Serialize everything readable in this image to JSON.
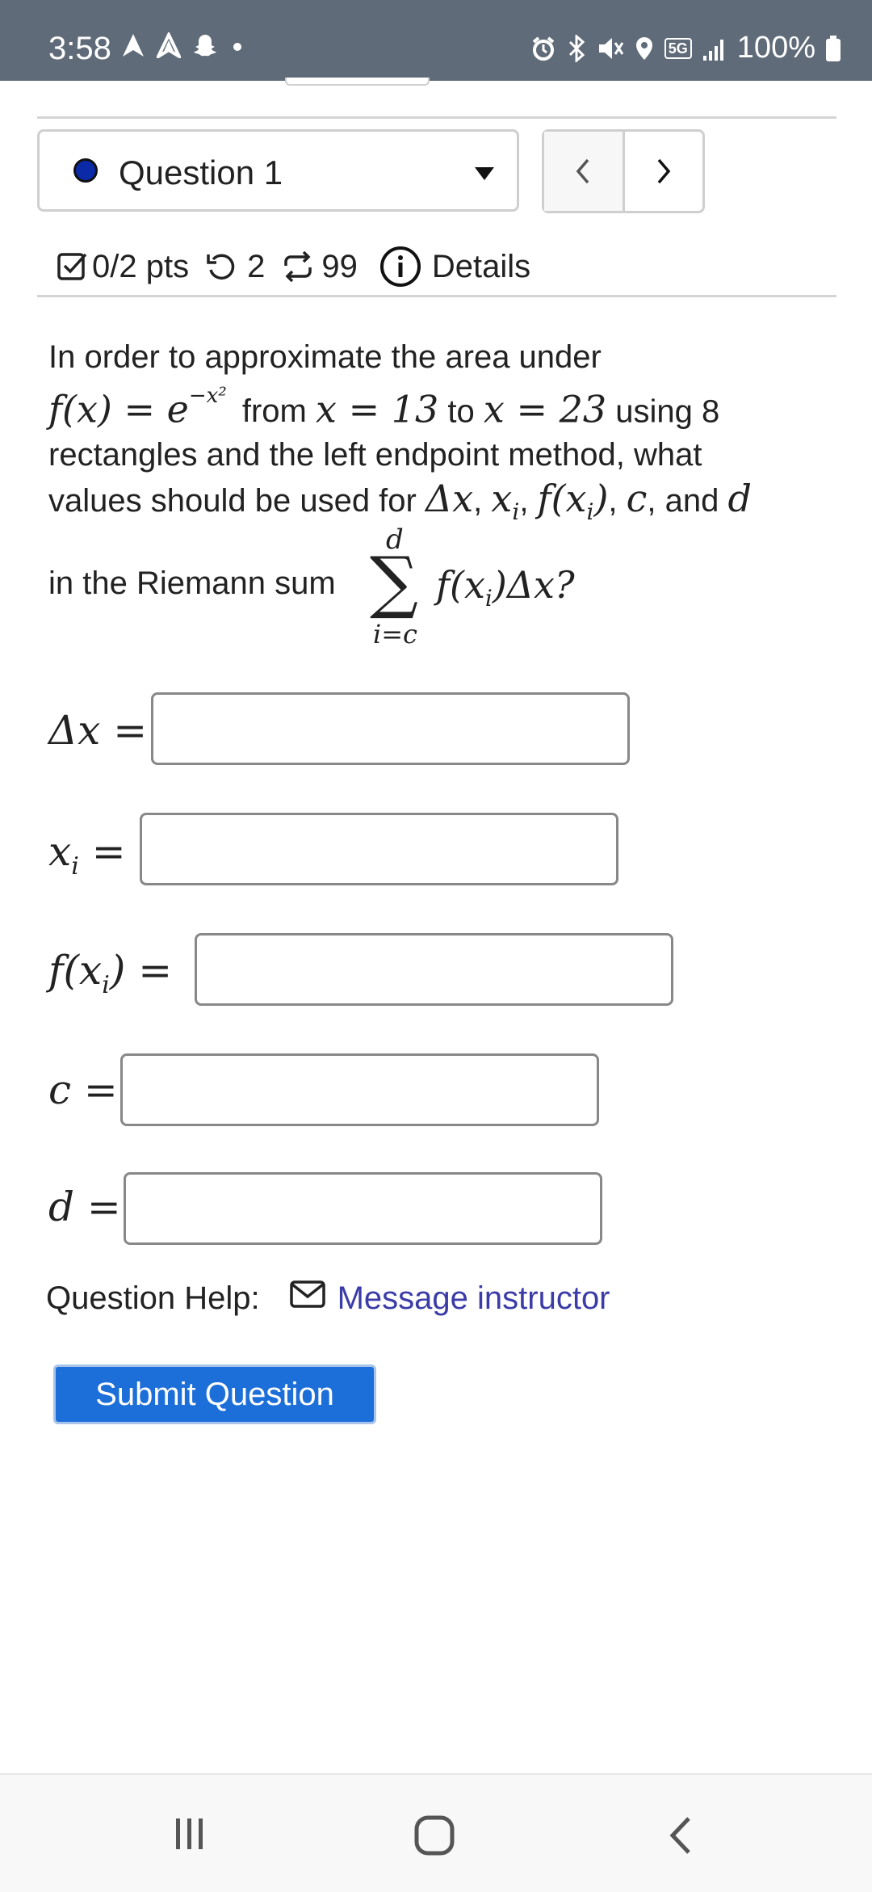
{
  "status_bar": {
    "time": "3:58",
    "battery": "100%",
    "icons_left": [
      "navigation-icon",
      "navigation-outline-icon",
      "snapchat-icon",
      "dot-icon"
    ],
    "icons_right": [
      "alarm-icon",
      "bluetooth-icon",
      "mute-icon",
      "location-icon",
      "5g-icon",
      "signal-icon",
      "battery-icon"
    ],
    "network": "5G"
  },
  "question_select": {
    "label": "Question 1",
    "dot_color": "#0a2aa8"
  },
  "meta": {
    "points": "0/2 pts",
    "retries": "2",
    "attempts": "99",
    "details": "Details"
  },
  "question": {
    "line1": "In order to approximate the area under",
    "fx": "f(x) = e",
    "exp": "−x²",
    "from": "from",
    "x_eq_13": "x = 13",
    "to": "to",
    "x_eq_23": "x = 23",
    "using": "using 8",
    "line3": "rectangles and the left endpoint method, what",
    "line4_pre": "values should be used for",
    "dx": "Δx",
    "xi": "x",
    "fxi": "f(x",
    "c": "c",
    "and": ", and",
    "d": "d",
    "line5": "in the Riemann sum",
    "sum_upper": "d",
    "sum_lower": "i=c",
    "sum_expr": "f(x",
    "sum_expr_end": ")Δx?"
  },
  "answers": {
    "dx_label": "Δx =",
    "xi_label": "x",
    "fxi_label": "f(x",
    "c_label": "c =",
    "d_label": "d ="
  },
  "help": {
    "label": "Question Help:",
    "link": "Message instructor"
  },
  "submit": {
    "label": "Submit Question"
  }
}
